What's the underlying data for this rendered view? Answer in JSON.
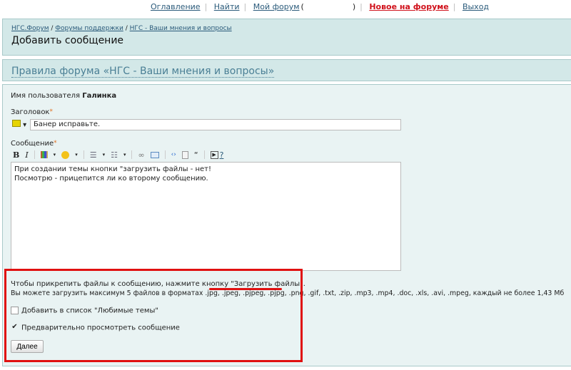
{
  "nav": {
    "items": [
      "Оглавление",
      "Найти",
      "Мой форум"
    ],
    "paren_open": "(",
    "paren_close": ")",
    "new": "Новое на форуме",
    "exit": "Выход"
  },
  "breadcrumb": [
    "НГС.Форум",
    "Форумы поддержки",
    "НГС - Ваши мнения и вопросы"
  ],
  "breadcrumb_sep": "/",
  "page_title": "Добавить сообщение",
  "rules_link": "Правила форума «НГС - Ваши мнения и вопросы»",
  "form": {
    "username_label": "Имя пользователя",
    "username": "Галинка",
    "subject_label": "Заголовок",
    "required": "*",
    "subject_value": "Банер исправьте.",
    "message_label": "Сообщение",
    "message_value": "При создании темы кнопки \"загрузить файлы - нет!\nПосмотрю - прицепится ли ко второму сообщению.",
    "toolbar": {
      "bold": "B",
      "italic": "I",
      "quote": "“",
      "help": "?"
    },
    "upload_text_1": "Чтобы прикрепить файлы к сообщению, нажмите кнопку ",
    "upload_button_ref": "\"Загрузить файлы\"",
    "upload_text_end": ".",
    "upload_limits": "Вы можете загрузить максимум 5 файлов в форматах .jpg, .jpeg, .pjpeg, .pjpg, .png, .gif, .txt, .zip, .mp3, .mp4, .doc, .xls, .avi, .mpeg, каждый не более 1,43 Мб",
    "favorite_label": "Добавить в список \"Любимые темы\"",
    "favorite_checked": false,
    "preview_label": "Предварительно просмотреть сообщение",
    "preview_checked": true,
    "next_button": "Далее"
  },
  "colors": {
    "accent_red": "#e01010",
    "panel": "#d3e8e8"
  }
}
